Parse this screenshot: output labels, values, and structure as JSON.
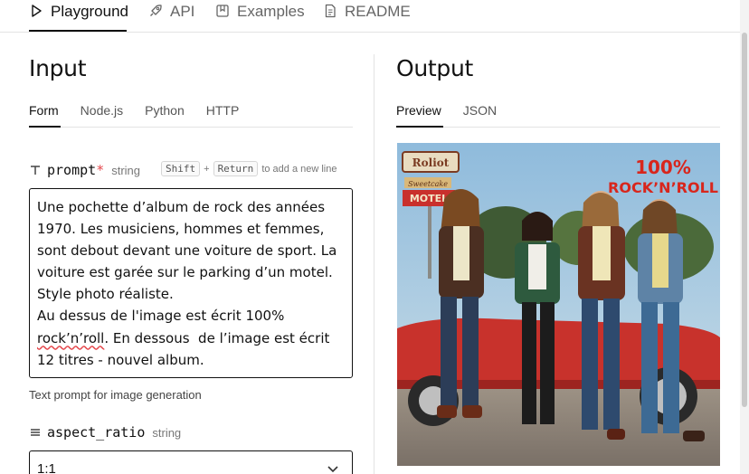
{
  "nav": {
    "items": [
      {
        "label": "Playground",
        "icon": "play-icon",
        "active": true
      },
      {
        "label": "API",
        "icon": "rocket-icon",
        "active": false
      },
      {
        "label": "Examples",
        "icon": "bookmark-icon",
        "active": false
      },
      {
        "label": "README",
        "icon": "document-icon",
        "active": false
      }
    ]
  },
  "input": {
    "title": "Input",
    "tabs": [
      "Form",
      "Node.js",
      "Python",
      "HTTP"
    ],
    "active_tab": "Form",
    "prompt_field": {
      "name": "prompt",
      "required_mark": "*",
      "type": "string",
      "hint_key1": "Shift",
      "hint_plus": "+",
      "hint_key2": "Return",
      "hint_text": "to add a new line",
      "value_part1": "Une pochette d’album de rock des années 1970. Les musiciens, hommes et femmes, sont debout devant une voiture de sport. La voiture est garée sur le parking d’un motel. Style photo réaliste.\nAu dessus de l'image est écrit 100% ",
      "value_misspelled": "rock’n’roll",
      "value_part2": ". En dessous  de l’image est écrit 12 titres - nouvel album.",
      "help": "Text prompt for image generation"
    },
    "aspect_field": {
      "name": "aspect_ratio",
      "type": "string",
      "value": "1:1"
    }
  },
  "output": {
    "title": "Output",
    "tabs": [
      "Preview",
      "JSON"
    ],
    "active_tab": "Preview",
    "image": {
      "headline_top": "100%",
      "headline_bottom": "ROCK’N’ROLL",
      "sign_top": "Roliot",
      "sign_mid": "Sweetcake",
      "sign_bottom": "MOTEL",
      "colors": {
        "sky": "#9ec4de",
        "car": "#c8322c",
        "title": "#d8261c"
      }
    }
  },
  "colors": {
    "required": "#e5484d",
    "border": "#111111",
    "muted": "#777777"
  }
}
